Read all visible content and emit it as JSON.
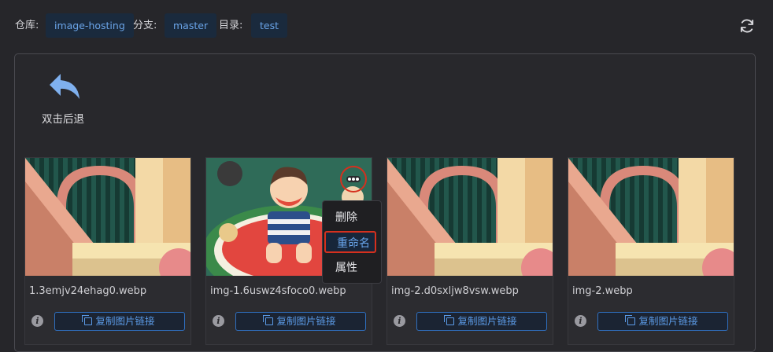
{
  "toolbar": {
    "repo_label": "仓库:",
    "repo_value": "image-hosting",
    "branch_label": "分支:",
    "branch_value": "master",
    "dir_label": "目录:",
    "dir_value": "test"
  },
  "back": {
    "label": "双击后退"
  },
  "cards": [
    {
      "filename": "1.3emjv24ehag0.webp",
      "copy_label": "复制图片链接",
      "thumb": "room-scene"
    },
    {
      "filename": "img-1.6uswz4sfoco0.webp",
      "copy_label": "复制图片链接",
      "thumb": "boy-watermelon"
    },
    {
      "filename": "img-2.d0sxljw8vsw.webp",
      "copy_label": "复制图片链接",
      "thumb": "room-scene"
    },
    {
      "filename": "img-2.webp",
      "copy_label": "复制图片链接",
      "thumb": "room-scene"
    }
  ],
  "context_menu": {
    "items": [
      {
        "label": "删除"
      },
      {
        "label": "重命名",
        "highlighted": true
      },
      {
        "label": "属性"
      }
    ]
  },
  "icons": {
    "refresh": "refresh-icon",
    "back": "back-arrow-icon",
    "info": "info-icon",
    "copy": "copy-icon",
    "more": "more-icon"
  },
  "colors": {
    "accent": "#5b9ae6",
    "highlight": "#d5301e",
    "background": "#26262a"
  }
}
